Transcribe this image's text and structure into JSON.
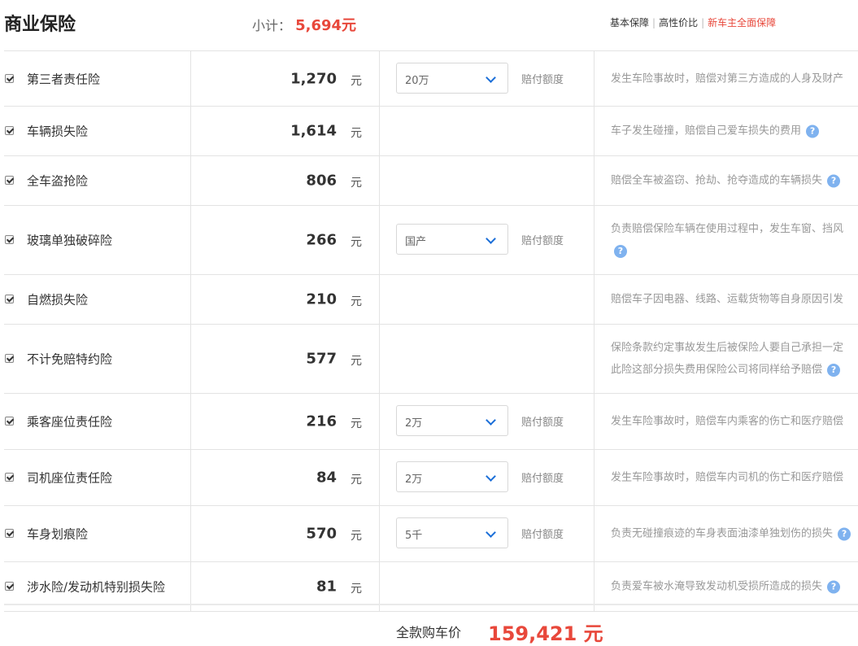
{
  "header": {
    "title": "商业保险",
    "subtotal_label": "小计：",
    "subtotal_value": "5,694元",
    "links": [
      "基本保障",
      "高性价比",
      "新车主全面保障"
    ],
    "active_link_color": "#e8483b"
  },
  "rows": [
    {
      "name": "第三者责任险",
      "price": "1,270",
      "unit": "元",
      "select": "20万",
      "option_label": "赔付额度",
      "desc": "发生车险事故时，赔偿对第三方造成的人身及财产",
      "help": false
    },
    {
      "name": "车辆损失险",
      "price": "1,614",
      "unit": "元",
      "select": null,
      "option_label": null,
      "desc": "车子发生碰撞，赔偿自己爱车损失的费用",
      "help": true
    },
    {
      "name": "全车盗抢险",
      "price": "806",
      "unit": "元",
      "select": null,
      "option_label": null,
      "desc": "赔偿全车被盗窃、抢劫、抢夺造成的车辆损失",
      "help": true
    },
    {
      "name": "玻璃单独破碎险",
      "price": "266",
      "unit": "元",
      "select": "国产",
      "option_label": "赔付额度",
      "desc": "负责赔偿保险车辆在使用过程中，发生车窗、挡风",
      "desc_help_newline": true,
      "help": true
    },
    {
      "name": "自燃损失险",
      "price": "210",
      "unit": "元",
      "select": null,
      "option_label": null,
      "desc": "赔偿车子因电器、线路、运载货物等自身原因引发",
      "help": false
    },
    {
      "name": "不计免赔特约险",
      "price": "577",
      "unit": "元",
      "select": null,
      "option_label": null,
      "desc": "保险条款约定事故发生后被保险人要自己承担一定",
      "desc2": "此险这部分损失费用保险公司将同样给予赔偿",
      "help": true
    },
    {
      "name": "乘客座位责任险",
      "price": "216",
      "unit": "元",
      "select": "2万",
      "option_label": "赔付额度",
      "desc": "发生车险事故时，赔偿车内乘客的伤亡和医疗赔偿",
      "help": false
    },
    {
      "name": "司机座位责任险",
      "price": "84",
      "unit": "元",
      "select": "2万",
      "option_label": "赔付额度",
      "desc": "发生车险事故时，赔偿车内司机的伤亡和医疗赔偿",
      "help": false
    },
    {
      "name": "车身划痕险",
      "price": "570",
      "unit": "元",
      "select": "5千",
      "option_label": "赔付额度",
      "desc": "负责无碰撞痕迹的车身表面油漆单独划伤的损失",
      "help": true
    },
    {
      "name": "涉水险/发动机特别损失险",
      "price": "81",
      "unit": "元",
      "select": null,
      "option_label": null,
      "desc": "负责爱车被水淹导致发动机受损所造成的损失",
      "help": true
    }
  ],
  "footer": {
    "total_label": "全款购车价",
    "total_value": "159,421 元"
  },
  "icons": {
    "help": "question-circle-icon",
    "checkbox": "checkbox-checked-icon",
    "select": "chevron-down-icon"
  },
  "help_glyph": "?"
}
